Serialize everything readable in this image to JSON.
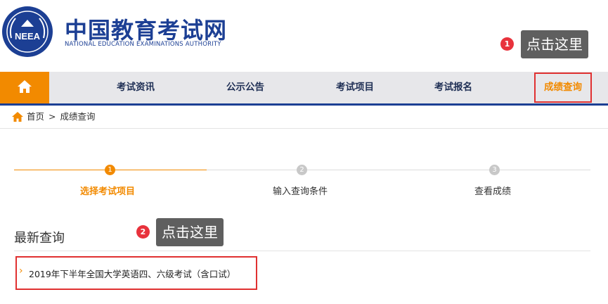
{
  "header": {
    "title_cn": "中国教育考试网",
    "title_en": "NATIONAL EDUCATION EXAMINATIONS AUTHORITY",
    "emblem_text": "NEEA"
  },
  "callouts": [
    {
      "badge": "1",
      "text": "点击这里"
    },
    {
      "badge": "2",
      "text": "点击这里"
    }
  ],
  "nav": {
    "home_icon": "home-icon",
    "items": [
      {
        "label": "考试资讯"
      },
      {
        "label": "公示公告"
      },
      {
        "label": "考试项目"
      },
      {
        "label": "考试报名"
      },
      {
        "label": "成绩查询",
        "active": true
      }
    ]
  },
  "breadcrumb": {
    "items": [
      "首页",
      "成绩查询"
    ],
    "separator": ">"
  },
  "steps": [
    {
      "num": "1",
      "label": "选择考试项目",
      "active": true
    },
    {
      "num": "2",
      "label": "输入查询条件",
      "active": false
    },
    {
      "num": "3",
      "label": "查看成绩",
      "active": false
    }
  ],
  "recent": {
    "title": "最新查询",
    "items": [
      {
        "label": "2019年下半年全国大学英语四、六级考试（含口试）"
      }
    ]
  },
  "colors": {
    "brand_blue": "#1c3f94",
    "accent_orange": "#f28a00",
    "highlight_red": "#e03131",
    "badge_red": "#e8323c",
    "callout_gray": "#5f5f5f",
    "inactive_gray": "#c8c8c8"
  }
}
